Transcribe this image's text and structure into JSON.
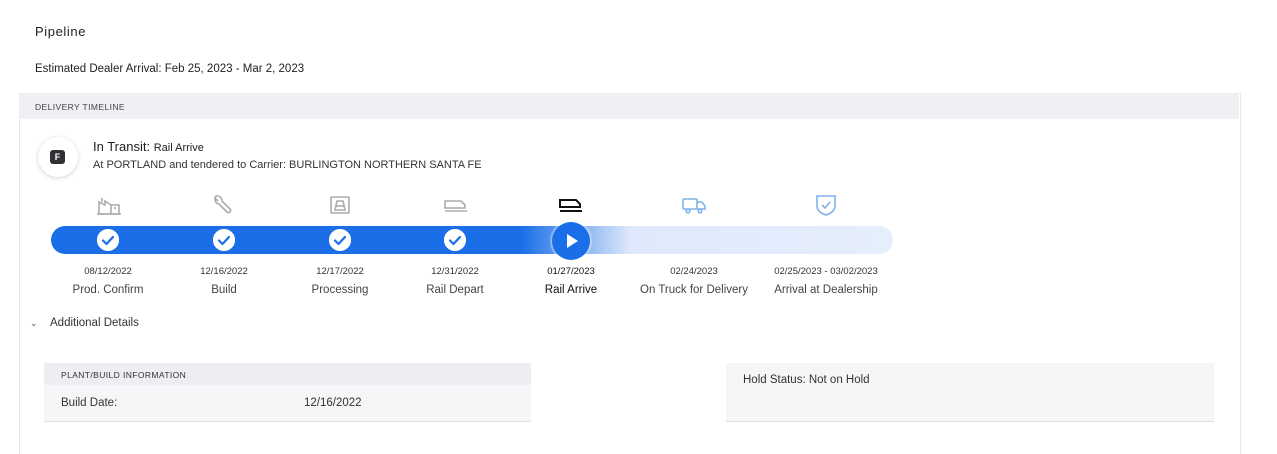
{
  "page": {
    "title": "Pipeline",
    "estimated_arrival": "Estimated Dealer Arrival: Feb 25, 2023 - Mar 2, 2023"
  },
  "timeline": {
    "header": "DELIVERY TIMELINE",
    "badge_letter": "F",
    "status_prefix": "In Transit: ",
    "status_value": "Rail Arrive",
    "status_detail": "At PORTLAND and tendered to Carrier: BURLINGTON NORTHERN SANTA FE",
    "steps": [
      {
        "date": "08/12/2022",
        "label": "Prod. Confirm",
        "icon": "factory-icon",
        "state": "complete"
      },
      {
        "date": "12/16/2022",
        "label": "Build",
        "icon": "wrench-icon",
        "state": "complete"
      },
      {
        "date": "12/17/2022",
        "label": "Processing",
        "icon": "car-seat-icon",
        "state": "complete"
      },
      {
        "date": "12/31/2022",
        "label": "Rail Depart",
        "icon": "rail-car-icon",
        "state": "complete"
      },
      {
        "date": "01/27/2023",
        "label": "Rail Arrive",
        "icon": "rail-car-icon",
        "state": "current"
      },
      {
        "date": "02/24/2023",
        "label": "On Truck for Delivery",
        "icon": "truck-icon",
        "state": "upcoming"
      },
      {
        "date": "02/25/2023 - 03/02/2023",
        "label": "Arrival at Dealership",
        "icon": "shield-check-icon",
        "state": "upcoming"
      }
    ],
    "colors": {
      "progress": "#1a6fe8",
      "track_remaining": "#e6eefc",
      "upcoming_icon": "#7fb2ea",
      "complete_icon": "#a9abae"
    }
  },
  "details": {
    "toggle_label": "Additional Details",
    "plant": {
      "header": "PLANT/BUILD INFORMATION",
      "build_date_label": "Build Date:",
      "build_date_value": "12/16/2022"
    },
    "hold_status": "Hold Status: Not on Hold"
  }
}
